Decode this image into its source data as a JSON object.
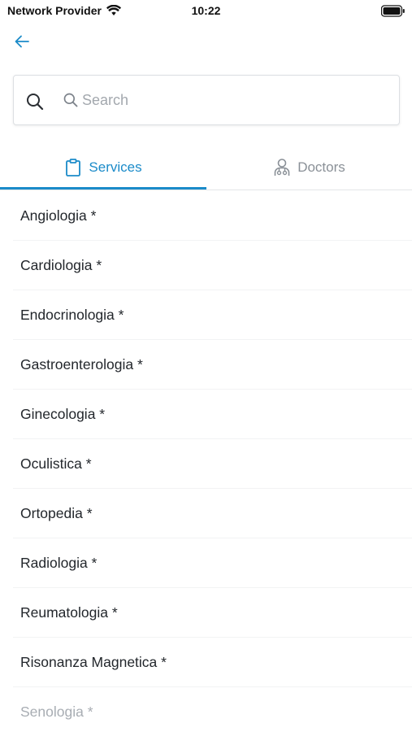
{
  "status_bar": {
    "carrier": "Network Provider",
    "time": "10:22"
  },
  "search": {
    "placeholder": "Search"
  },
  "tabs": [
    {
      "label": "Services",
      "icon": "clipboard-icon",
      "active": true
    },
    {
      "label": "Doctors",
      "icon": "doctor-icon",
      "active": false
    }
  ],
  "colors": {
    "accent": "#1b8bc9",
    "inactive": "#8a9097"
  },
  "services": [
    {
      "label": "Angiologia *"
    },
    {
      "label": "Cardiologia *"
    },
    {
      "label": "Endocrinologia *"
    },
    {
      "label": "Gastroenterologia *"
    },
    {
      "label": "Ginecologia *"
    },
    {
      "label": "Oculistica *"
    },
    {
      "label": "Ortopedia *"
    },
    {
      "label": "Radiologia *"
    },
    {
      "label": "Reumatologia *"
    },
    {
      "label": "Risonanza Magnetica *"
    },
    {
      "label": "Senologia *"
    }
  ]
}
